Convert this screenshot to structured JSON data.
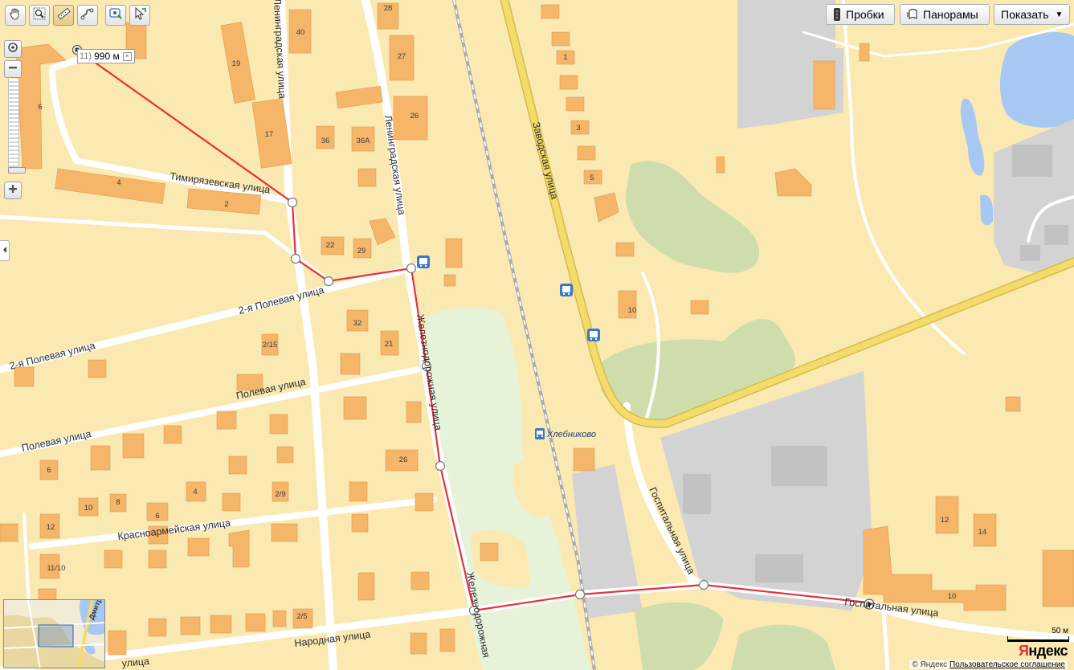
{
  "map": {
    "street_labels": [
      "Тимирязевская улица",
      "Ленинградская улица",
      "Ленинградская улица",
      "2-я Полевая улица",
      "2-я Полевая улица",
      "Полевая улица",
      "Полевая улица",
      "Красноармейская улица",
      "Народная улица",
      "улица",
      "Железнодорожная улица",
      "Железнодорожная",
      "Заводская улица",
      "Госпитальная улица",
      "Госпитальная улица"
    ],
    "house_numbers": [
      "28",
      "40",
      "27",
      "19",
      "1",
      "6",
      "17",
      "26",
      "36",
      "36А",
      "3",
      "5",
      "4",
      "2",
      "22",
      "29",
      "32",
      "2/15",
      "21",
      "10",
      "6",
      "8",
      "10",
      "4",
      "6",
      "2/9",
      "12",
      "11/10",
      "26",
      "2/5",
      "12",
      "14",
      "10"
    ],
    "station_label": "Хлебниково",
    "colors": {
      "land": "#fbe9b2",
      "building": "#f5b66a",
      "park": "#cfddac",
      "rail_zone": "#e6f3d9",
      "industrial": "#d3d3d3",
      "water": "#a7c8f2",
      "main_road": "#f4dc6a",
      "route_line": "#e8303a"
    },
    "icons": [
      "bus-stop-icon",
      "bus-stop-icon",
      "bus-stop-icon",
      "train-station-icon"
    ]
  },
  "toolbar": {
    "tools": [
      "hand-icon",
      "magnifier-icon",
      "ruler-icon",
      "route-icon",
      "point-icon",
      "cursor-icon"
    ],
    "active_tool": "ruler-icon"
  },
  "top_buttons": {
    "traffic": "Пробки",
    "panoramas": "Панорамы",
    "show": "Показать",
    "show_arrow": "▼"
  },
  "ruler": {
    "segment_number": "11)",
    "distance": "990 м",
    "close": "×"
  },
  "scale": {
    "label": "50 м"
  },
  "logo": {
    "first": "Я",
    "rest": "ндекс"
  },
  "footer": {
    "copyright": "© Яндекс",
    "agreement_link": "Пользовательское соглашение"
  },
  "minimap": {
    "road_label": "Дмитр"
  }
}
